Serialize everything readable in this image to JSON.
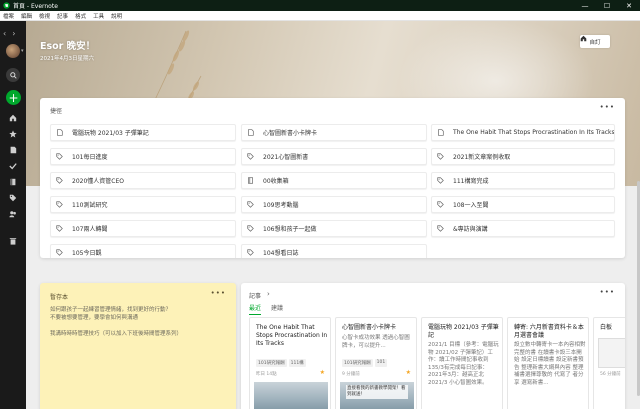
{
  "window": {
    "title": "首頁 - Evernote",
    "minimize": "—",
    "maximize": "☐",
    "close": "✕"
  },
  "menu": [
    "檔案",
    "編輯",
    "檢視",
    "記事",
    "格式",
    "工具",
    "說明"
  ],
  "rail": {
    "back": "‹",
    "forward": "›",
    "new_icon": "+"
  },
  "hero": {
    "greeting": "Esor 晚安！",
    "date": "2021年4月3日星期六",
    "customize_label": "自訂"
  },
  "pinned": {
    "header": "捷徑",
    "more": "•••",
    "items": [
      {
        "label": "電腦玩物 2021/03 子彈筆記",
        "icon": "note-icon"
      },
      {
        "label": "心智圖新書小卡牌卡",
        "icon": "note-icon"
      },
      {
        "label": "The One Habit That Stops Procrastination In Its Tracks",
        "icon": "note-icon"
      },
      {
        "label": "101每日進度",
        "icon": "tag-icon"
      },
      {
        "label": "2021心智圖新書",
        "icon": "tag-icon"
      },
      {
        "label": "2021新文章案例收取",
        "icon": "tag-icon"
      },
      {
        "label": "2020懂人資管CEO",
        "icon": "tag-icon"
      },
      {
        "label": "00收集箱",
        "icon": "notebook-icon"
      },
      {
        "label": "111構寫完成",
        "icon": "tag-icon"
      },
      {
        "label": "110測試研究",
        "icon": "tag-icon"
      },
      {
        "label": "109思考動腦",
        "icon": "tag-icon"
      },
      {
        "label": "108一入至聞",
        "icon": "tag-icon"
      },
      {
        "label": "107兩人轉聞",
        "icon": "tag-icon"
      },
      {
        "label": "106想和孩子一起做",
        "icon": "tag-icon"
      },
      {
        "label": "&專訪與演講",
        "icon": "tag-icon"
      },
      {
        "label": "105今日觀",
        "icon": "tag-icon"
      },
      {
        "label": "104想看日誌",
        "icon": "tag-icon"
      }
    ]
  },
  "scratch": {
    "header": "暫存本",
    "more": "•••",
    "lines": [
      "如何跟孩子一起練習管理情緒，找到更好的行動？",
      "不要被想要管理，要學會如何與溝通",
      "我溝時時時管理技巧（可以加入下班後時間管理系列）"
    ]
  },
  "notes": {
    "header": "記事",
    "arrow": "›",
    "more": "•••",
    "tabs": [
      "最近",
      "建議"
    ],
    "cards": [
      {
        "title": "The One Habit That Stops Procrastination In Its Tracks",
        "tags": [
          "101研究報酬",
          "111構"
        ],
        "date": "昨日 14點",
        "starred": true,
        "thumb_text": ""
      },
      {
        "title": "心智圖新書小卡牌卡",
        "body": "心智卡成功效果 透過心智圖牌卡，可以提升...",
        "tags": [
          "101研究報酬",
          "101"
        ],
        "date": "9 分鐘前",
        "starred": true,
        "thumb_text": "直接看我的新書教學開架！看到就送！"
      },
      {
        "title": "電腦玩物 2021/03 子彈筆記",
        "body": "2021/1 目標（參考：電腦玩物 2021/02 子彈筆記）工作：讀工作時間記事收到135/3有完成每日記事：2021年3月：越高正北2021/3 小心智圖效果。",
        "tags": [],
        "date": "",
        "starred": false,
        "thumb_text": ""
      },
      {
        "title": "轉寄: 六月新書資料卡＆本月選書會議",
        "body": "設立數中轉寄卡一本內容相對完整的書 在讀書卡設三本開始 設定日標讀書 設定新書預告 整理新書大綱與內容 整理補書選擇尊敬的 代寫了 者分享 選寫新書...",
        "tags": [],
        "date": "",
        "starred": false,
        "thumb_text": ""
      },
      {
        "title": "白板",
        "body": "",
        "tags": [],
        "date": "56 分鐘前",
        "starred": false,
        "thumb_text": ""
      }
    ]
  },
  "colors": {
    "accent": "#00a82d",
    "rail": "#1a1a1a",
    "scratch_bg": "#fdf2b8",
    "star": "#f4a623"
  }
}
